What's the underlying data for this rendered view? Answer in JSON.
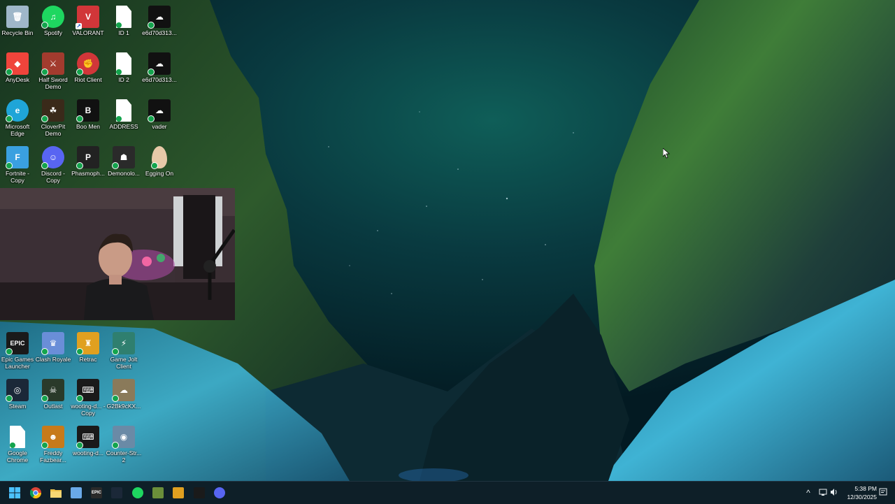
{
  "desktop": {
    "icons": [
      {
        "label": "Recycle Bin",
        "icon": "recycle-bin-icon",
        "color": "#9fb7c9"
      },
      {
        "label": "Spotify",
        "icon": "spotify-icon",
        "color": "#1ed760"
      },
      {
        "label": "VALORANT",
        "icon": "valorant-icon",
        "color": "#d13639"
      },
      {
        "label": "ID 1",
        "icon": "text-file-icon",
        "color": "#ffffff"
      },
      {
        "label": "e6d70d313...",
        "icon": "image-file-icon",
        "color": "#111111"
      },
      {
        "label": "AnyDesk",
        "icon": "anydesk-icon",
        "color": "#ef443b"
      },
      {
        "label": "Half Sword Demo",
        "icon": "half-sword-icon",
        "color": "#a23b2e"
      },
      {
        "label": "Riot Client",
        "icon": "riot-client-icon",
        "color": "#d13639"
      },
      {
        "label": "ID 2",
        "icon": "text-file-icon",
        "color": "#ffffff"
      },
      {
        "label": "e6d70d313...",
        "icon": "image-file-icon",
        "color": "#111111"
      },
      {
        "label": "Microsoft Edge",
        "icon": "edge-icon",
        "color": "#1fa5d8"
      },
      {
        "label": "CloverPit Demo",
        "icon": "cloverpit-icon",
        "color": "#3a2a1a"
      },
      {
        "label": "Boo Men",
        "icon": "boo-men-icon",
        "color": "#111111"
      },
      {
        "label": "ADDRESS",
        "icon": "text-file-icon",
        "color": "#ffffff"
      },
      {
        "label": "vader",
        "icon": "image-file-icon",
        "color": "#111111"
      },
      {
        "label": "Fortnite - Copy",
        "icon": "fortnite-icon",
        "color": "#3aa0e0"
      },
      {
        "label": "Discord - Copy",
        "icon": "discord-icon",
        "color": "#5865f2"
      },
      {
        "label": "Phasmoph...",
        "icon": "phasmophobia-icon",
        "color": "#222222"
      },
      {
        "label": "Demonolo...",
        "icon": "demonologist-icon",
        "color": "#2a2a2a"
      },
      {
        "label": "Egging On",
        "icon": "egg-icon",
        "color": "#e7c9a8"
      },
      {
        "label": "Epic Games Launcher",
        "icon": "epic-games-icon",
        "color": "#1a1a1a"
      },
      {
        "label": "Clash Royale",
        "icon": "clash-royale-icon",
        "color": "#6a8ed8"
      },
      {
        "label": "Retrac",
        "icon": "retrac-icon",
        "color": "#e0a020"
      },
      {
        "label": "Game Jolt Client",
        "icon": "game-jolt-icon",
        "color": "#2f7f6f"
      },
      {
        "label": "Steam",
        "icon": "steam-icon",
        "color": "#1b2838"
      },
      {
        "label": "Outlast",
        "icon": "outlast-icon",
        "color": "#2a3a2a"
      },
      {
        "label": "wooting-d... - Copy",
        "icon": "wooting-icon",
        "color": "#1a1a1a"
      },
      {
        "label": "G2Bk9cKX...",
        "icon": "image-file-icon",
        "color": "#8a7a5a"
      },
      {
        "label": "Google Chrome",
        "icon": "text-file-icon",
        "color": "#ffffff"
      },
      {
        "label": "Freddy Fazbear...",
        "icon": "freddy-fazbear-icon",
        "color": "#c77a1a"
      },
      {
        "label": "wooting-d...",
        "icon": "wooting-icon",
        "color": "#1a1a1a"
      },
      {
        "label": "Counter-Str... 2",
        "icon": "counter-strike-icon",
        "color": "#6a8aa6"
      }
    ]
  },
  "taskbar": {
    "pinned": [
      {
        "name": "start-button",
        "glyph": "",
        "color": "#3b9dea"
      },
      {
        "name": "chrome-taskbar-button",
        "glyph": "",
        "color": "#e6b316"
      },
      {
        "name": "file-explorer-taskbar-button",
        "glyph": "",
        "color": "#f0c24a"
      },
      {
        "name": "app-taskbar-button",
        "glyph": "",
        "color": "#6aa9e8"
      },
      {
        "name": "epic-games-taskbar-button",
        "glyph": "EPIC",
        "color": "#2a2a2a"
      },
      {
        "name": "steam-taskbar-button",
        "glyph": "",
        "color": "#1b2838"
      },
      {
        "name": "spotify-taskbar-button",
        "glyph": "",
        "color": "#1ed760"
      },
      {
        "name": "minecraft-taskbar-button",
        "glyph": "",
        "color": "#6b8f3a"
      },
      {
        "name": "retrac-taskbar-button",
        "glyph": "",
        "color": "#e0a020"
      },
      {
        "name": "wooting-taskbar-button",
        "glyph": "",
        "color": "#1a1a1a"
      },
      {
        "name": "discord-taskbar-button",
        "glyph": "",
        "color": "#5865f2"
      }
    ],
    "tray": {
      "chevron": "^",
      "time": "5:38 PM",
      "date": "12/30/2025"
    }
  },
  "colors": {
    "taskbar": "#0e1f28",
    "sky_top": "#052d33",
    "aurora": "#0f6b5e",
    "rock_green": "#4a8a3a",
    "snow": "#3aa8c8"
  }
}
